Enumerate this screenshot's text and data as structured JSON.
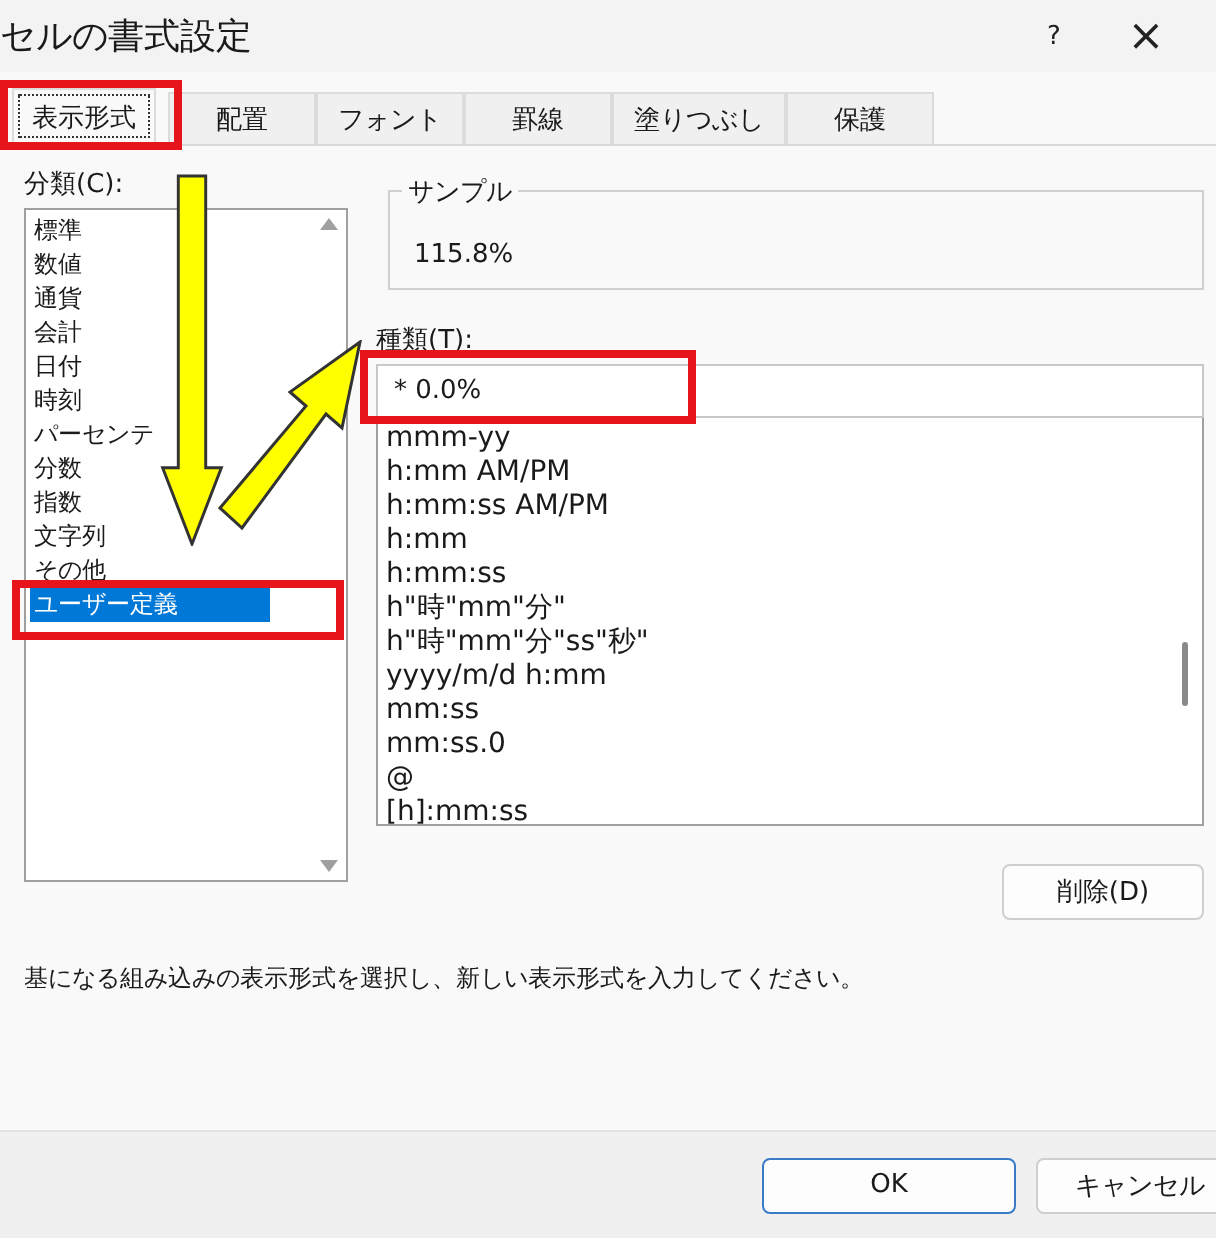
{
  "window": {
    "title": "セルの書式設定",
    "help": "?",
    "close": "×"
  },
  "tabs": [
    {
      "label": "表示形式",
      "selected": true
    },
    {
      "label": "配置",
      "selected": false
    },
    {
      "label": "フォント",
      "selected": false
    },
    {
      "label": "罫線",
      "selected": false
    },
    {
      "label": "塗りつぶし",
      "selected": false
    },
    {
      "label": "保護",
      "selected": false
    }
  ],
  "category": {
    "label": "分類(C):",
    "items": [
      {
        "label": "標準",
        "selected": false
      },
      {
        "label": "数値",
        "selected": false
      },
      {
        "label": "通貨",
        "selected": false
      },
      {
        "label": "会計",
        "selected": false
      },
      {
        "label": "日付",
        "selected": false
      },
      {
        "label": "時刻",
        "selected": false
      },
      {
        "label": "パーセンテ",
        "selected": false
      },
      {
        "label": "分数",
        "selected": false
      },
      {
        "label": "指数",
        "selected": false
      },
      {
        "label": "文字列",
        "selected": false
      },
      {
        "label": "その他",
        "selected": false
      },
      {
        "label": "ユーザー定義",
        "selected": true
      }
    ]
  },
  "sample": {
    "label": "サンプル",
    "value": "115.8%"
  },
  "type": {
    "label": "種類(T):",
    "value": "* 0.0%",
    "items": [
      {
        "label": "mmm-yy",
        "selected": false
      },
      {
        "label": "h:mm AM/PM",
        "selected": false
      },
      {
        "label": "h:mm:ss AM/PM",
        "selected": false
      },
      {
        "label": "h:mm",
        "selected": false
      },
      {
        "label": "h:mm:ss",
        "selected": false
      },
      {
        "label": "h\"時\"mm\"分\"",
        "selected": false
      },
      {
        "label": "h\"時\"mm\"分\"ss\"秒\"",
        "selected": false
      },
      {
        "label": "yyyy/m/d h:mm",
        "selected": false
      },
      {
        "label": "mm:ss",
        "selected": false
      },
      {
        "label": "mm:ss.0",
        "selected": false
      },
      {
        "label": "@",
        "selected": false
      },
      {
        "label": "[h]:mm:ss",
        "selected": false
      }
    ]
  },
  "delete_button": "削除(D)",
  "description": "基になる組み込みの表示形式を選択し、新しい表示形式を入力してください。",
  "buttons": [
    {
      "label": "OK",
      "kind": "default"
    },
    {
      "label": "キャンセル",
      "kind": "normal"
    }
  ]
}
